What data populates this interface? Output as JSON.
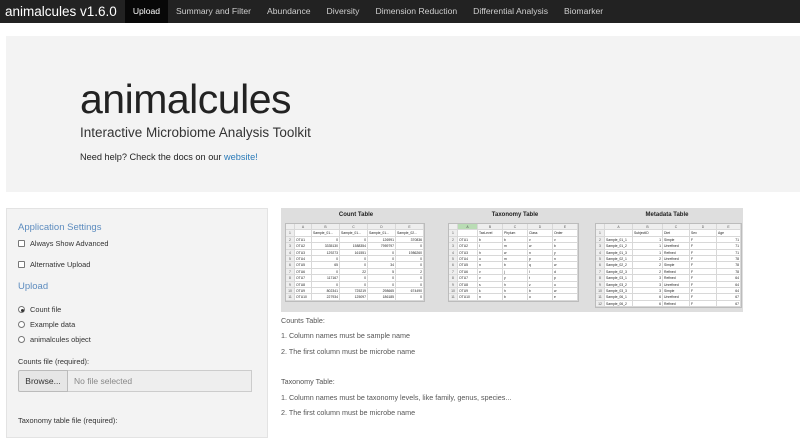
{
  "navbar": {
    "brand": "animalcules v1.6.0",
    "tabs": [
      "Upload",
      "Summary and Filter",
      "Abundance",
      "Diversity",
      "Dimension Reduction",
      "Differential Analysis",
      "Biomarker"
    ]
  },
  "jumbotron": {
    "title": "animalcules",
    "subtitle": "Interactive Microbiome Analysis Toolkit",
    "help_prefix": "Need help? Check the docs on our ",
    "help_link": "website!"
  },
  "sidebar": {
    "settings_title": "Application Settings",
    "always_show_advanced": "Always Show Advanced",
    "alternative_upload": "Alternative Upload",
    "upload_title": "Upload",
    "radio_options": [
      "Count file",
      "Example data",
      "animalcules object"
    ],
    "counts_label": "Counts file (required):",
    "browse_label": "Browse...",
    "file_placeholder": "No file selected",
    "taxonomy_label": "Taxonomy table file (required):"
  },
  "example_tables": {
    "count": {
      "title": "Count Table",
      "columns": [
        "A",
        "B",
        "C",
        "D",
        "E"
      ],
      "rows": [
        [
          "",
          "Sample_01...",
          "Sample_01...",
          "Sample_01...",
          "Sample_02..."
        ],
        [
          "OTU1",
          "0",
          "0",
          "126991",
          "370836"
        ],
        [
          "OTU2",
          "3335130",
          "1588354",
          "7959797",
          "0"
        ],
        [
          "OTU3",
          "129273",
          "161551",
          "0",
          "1986260"
        ],
        [
          "OTU4",
          "0",
          "0",
          "0",
          "0"
        ],
        [
          "OTU5",
          "65",
          "0",
          "34",
          "0"
        ],
        [
          "OTU6",
          "0",
          "22",
          "5",
          "2"
        ],
        [
          "OTU7",
          "117167",
          "0",
          "0",
          "0"
        ],
        [
          "OTU8",
          "0",
          "0",
          "0",
          "0"
        ],
        [
          "OTU9",
          "802341",
          "725219",
          "298665",
          "674490"
        ],
        [
          "OTU10",
          "227934",
          "125097",
          "186185",
          "0"
        ]
      ]
    },
    "taxonomy": {
      "title": "Taxonomy Table",
      "columns": [
        "A",
        "B",
        "C",
        "D",
        "E"
      ],
      "rows": [
        [
          "",
          "TaxLevel",
          "Phylum",
          "Class",
          "Order"
        ],
        [
          "OTU1",
          "b",
          "b",
          "v",
          "v"
        ],
        [
          "OTU2",
          "l",
          "m",
          "w",
          "b"
        ],
        [
          "OTU3",
          "h",
          "w",
          "n",
          "y"
        ],
        [
          "OTU4",
          "u",
          "m",
          "p",
          "n"
        ],
        [
          "OTU5",
          "n",
          "b",
          "q",
          "w"
        ],
        [
          "OTU6",
          "v",
          "j",
          "l",
          "d"
        ],
        [
          "OTU7",
          "v",
          "y",
          "t",
          "p"
        ],
        [
          "OTU8",
          "s",
          "h",
          "z",
          "u"
        ],
        [
          "OTU9",
          "k",
          "h",
          "b",
          "w"
        ],
        [
          "OTU10",
          "n",
          "b",
          "o",
          "e"
        ]
      ]
    },
    "metadata": {
      "title": "Metadata Table",
      "columns": [
        "A",
        "B",
        "C",
        "D",
        "E"
      ],
      "rows": [
        [
          "",
          "SubjectID",
          "Diet",
          "Sex",
          "Age"
        ],
        [
          "Sample_01_1",
          "1",
          "Simple",
          "F",
          "71"
        ],
        [
          "Sample_01_2",
          "1",
          "Unrefined",
          "F",
          "71"
        ],
        [
          "Sample_01_3",
          "1",
          "Refined",
          "F",
          "71"
        ],
        [
          "Sample_02_1",
          "2",
          "Unrefined",
          "F",
          "78"
        ],
        [
          "Sample_02_2",
          "2",
          "Simple",
          "F",
          "78"
        ],
        [
          "Sample_02_3",
          "2",
          "Refined",
          "F",
          "78"
        ],
        [
          "Sample_03_1",
          "3",
          "Refined",
          "F",
          "64"
        ],
        [
          "Sample_03_2",
          "3",
          "Unrefined",
          "F",
          "64"
        ],
        [
          "Sample_03_3",
          "3",
          "Simple",
          "F",
          "64"
        ],
        [
          "Sample_06_1",
          "6",
          "Unrefined",
          "F",
          "67"
        ],
        [
          "Sample_06_2",
          "6",
          "Refined",
          "F",
          "67"
        ]
      ]
    }
  },
  "notes": {
    "counts_heading": "Counts Table:",
    "counts_rule1": "1. Column names must be sample name",
    "counts_rule2": "2. The first column must be microbe name",
    "taxonomy_heading": "Taxonomy Table:",
    "taxonomy_rule1": "1. Column names must be taxonomy levels, like family, genus, species...",
    "taxonomy_rule2": "2. The first column must be microbe name"
  },
  "colors": {
    "navbar_bg": "#222222",
    "active_tab_bg": "#080808",
    "accent": "#5d8cbf",
    "link": "#2a7ab8"
  }
}
